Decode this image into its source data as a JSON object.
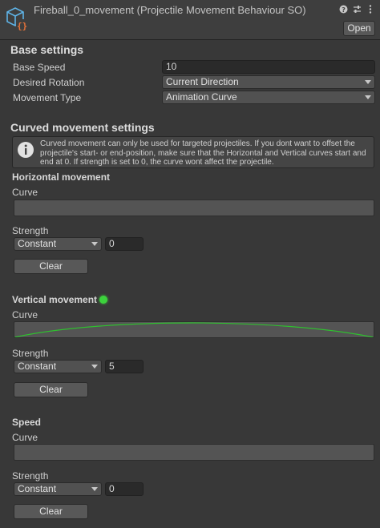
{
  "header": {
    "title": "Fireball_0_movement (Projectile Movement Behaviour SO)",
    "open_label": "Open",
    "icons": [
      "help-icon",
      "settings-sliders-icon",
      "more-options-icon"
    ]
  },
  "base_settings": {
    "heading": "Base settings",
    "speed_label": "Base Speed",
    "speed_value": "10",
    "rotation_label": "Desired Rotation",
    "rotation_value": "Current Direction",
    "movement_label": "Movement Type",
    "movement_value": "Animation Curve"
  },
  "curved": {
    "heading": "Curved movement settings",
    "help_text": "Curved movement can only be used for targeted projectiles. If you dont want to offset the projectile's start- or end-position, make sure that the Horizontal and Vertical curves start and end at 0. If strength is set to 0, the curve wont affect the projectile."
  },
  "horizontal": {
    "heading": "Horizontal movement",
    "curve_label": "Curve",
    "strength_label": "Strength",
    "strength_mode": "Constant",
    "strength_value": "0",
    "clear_label": "Clear"
  },
  "vertical": {
    "heading": "Vertical movement",
    "curve_label": "Curve",
    "strength_label": "Strength",
    "strength_mode": "Constant",
    "strength_value": "5",
    "clear_label": "Clear",
    "curve_color": "#2fbf2f",
    "status_color": "#3cd23c"
  },
  "speed": {
    "heading": "Speed",
    "curve_label": "Curve",
    "strength_label": "Strength",
    "strength_mode": "Constant",
    "strength_value": "0",
    "clear_label": "Clear"
  }
}
